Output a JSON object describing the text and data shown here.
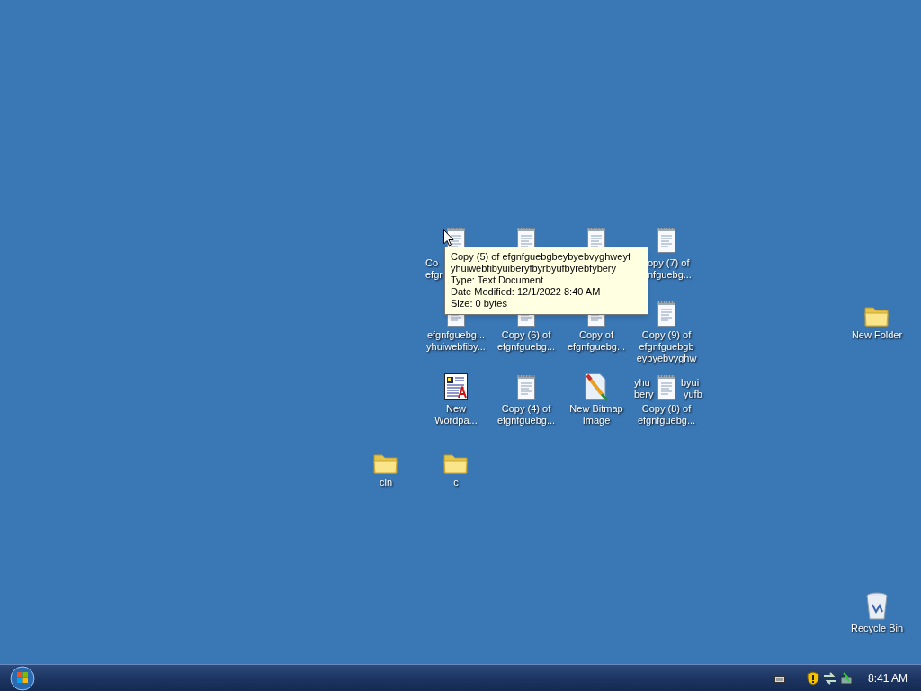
{
  "desktop": {
    "icons": [
      {
        "kind": "text",
        "label": [
          "Co",
          "efgr"
        ]
      },
      {
        "kind": "text"
      },
      {
        "kind": "text"
      },
      {
        "kind": "text",
        "label": [
          "opy (7) of",
          "nfguebg..."
        ]
      },
      {
        "kind": "text",
        "label": [
          "efgnfguebg...",
          "yhuiwebfiby..."
        ]
      },
      {
        "kind": "text",
        "label": [
          "Copy (6) of",
          "efgnfguebg..."
        ]
      },
      {
        "kind": "text",
        "label": [
          "Copy of",
          "efgnfguebg..."
        ]
      },
      {
        "kind": "text",
        "label": [
          "Copy (9) of",
          "efgnfguebgb",
          "eybyebvyghw"
        ],
        "covered_parts": [
          "yhu",
          "byui",
          "bery",
          "yufb"
        ]
      },
      {
        "kind": "wordpad",
        "label": [
          "New",
          "Wordpa..."
        ]
      },
      {
        "kind": "text",
        "label": [
          "Copy (4) of",
          "efgnfguebg..."
        ]
      },
      {
        "kind": "bitmap",
        "label": [
          "New Bitmap",
          "Image"
        ]
      },
      {
        "kind": "text",
        "label": [
          "Copy (8) of",
          "efgnfguebg..."
        ]
      },
      {
        "kind": "folder",
        "label": [
          "cin"
        ]
      },
      {
        "kind": "folder",
        "label": [
          "c"
        ]
      },
      {
        "kind": "folder",
        "label": [
          "New Folder"
        ]
      },
      {
        "kind": "recycle",
        "label": [
          "Recycle Bin"
        ]
      }
    ]
  },
  "tooltip": {
    "lines": [
      "Copy (5) of efgnfguebgbeybyebvyghweyf",
      "yhuiwebfibyuiberyfbyrbyufbyrebfybery",
      "Type: Text Document",
      "Date Modified: 12/1/2022 8:40 AM",
      "Size: 0 bytes"
    ]
  },
  "taskbar": {
    "clock": "8:41 AM"
  }
}
